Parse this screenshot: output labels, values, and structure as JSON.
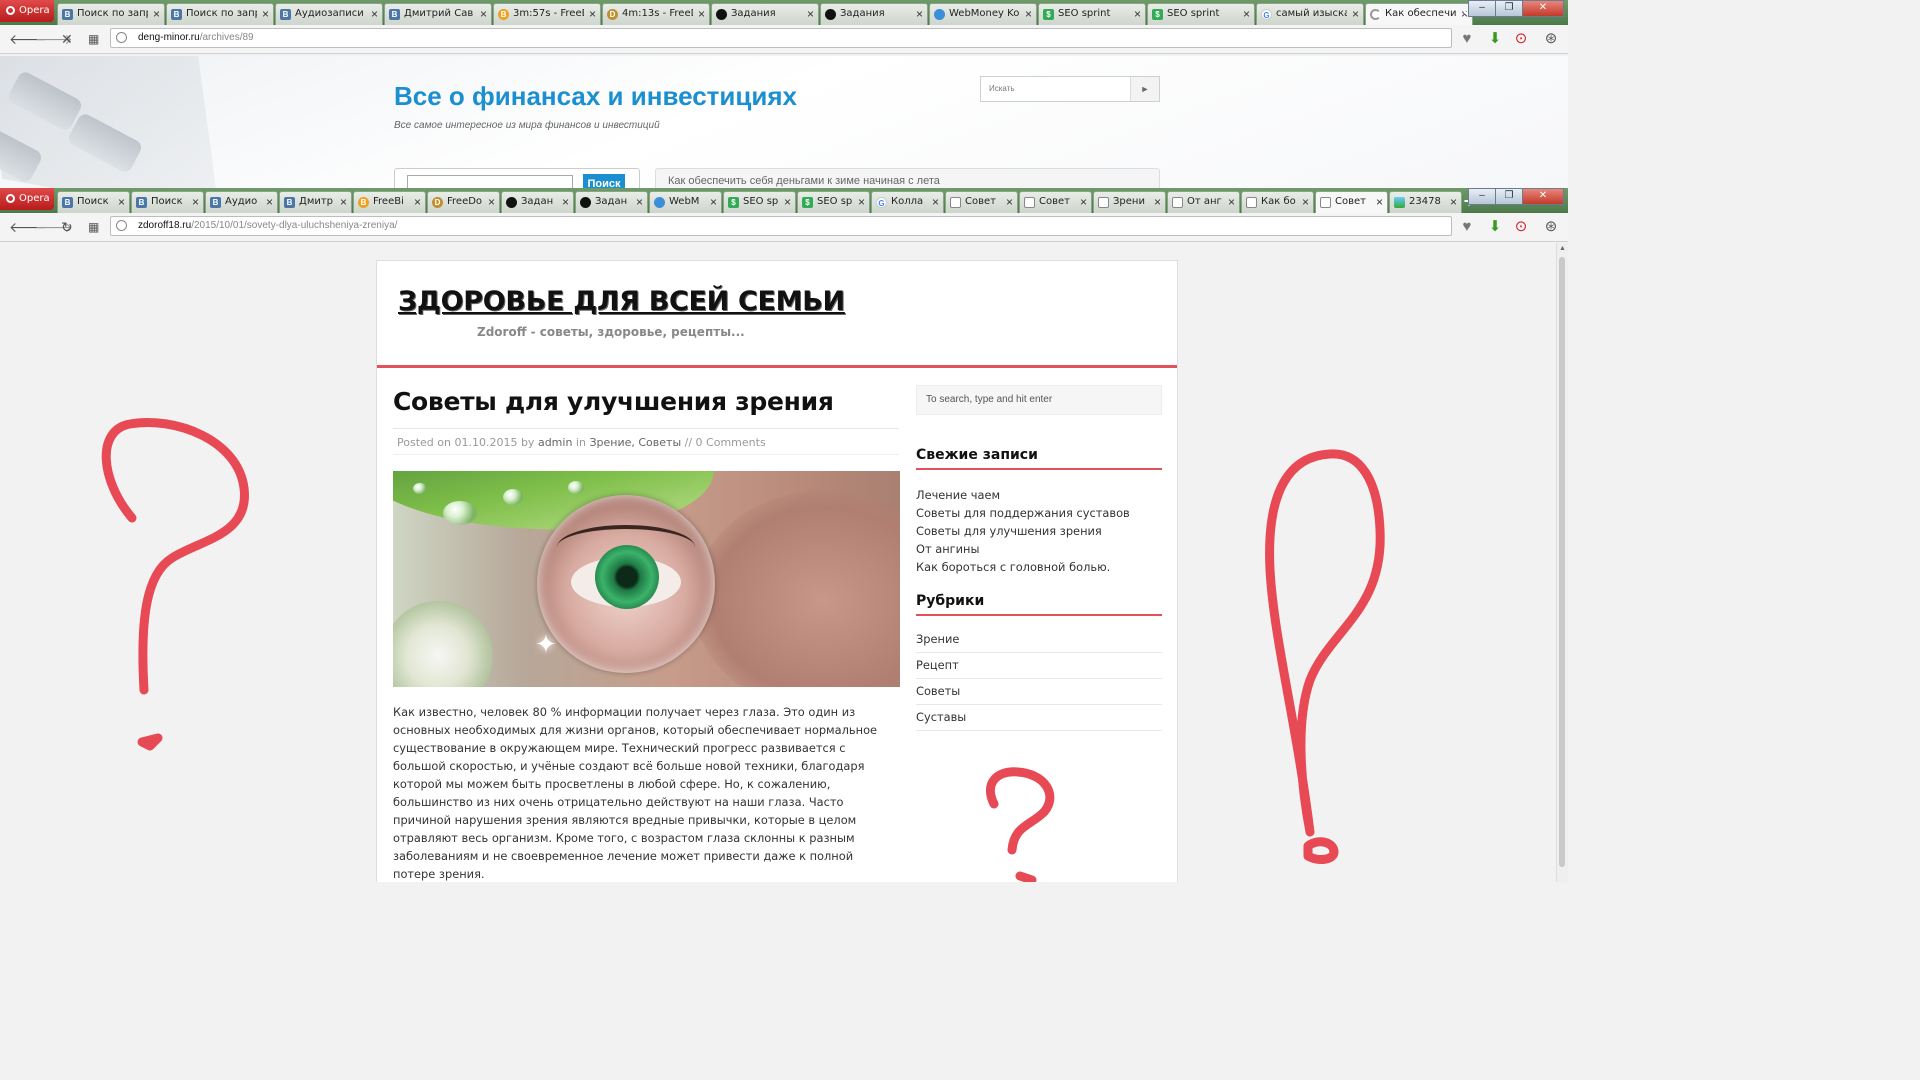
{
  "back_window": {
    "opera_label": "Opera",
    "tabs": [
      {
        "label": "Поиск по запр",
        "icon": "vk"
      },
      {
        "label": "Поиск по запр",
        "icon": "vk"
      },
      {
        "label": "Аудиозаписи Д",
        "icon": "vk"
      },
      {
        "label": "Дмитрий Сав",
        "icon": "vk"
      },
      {
        "label": "3m:57s - FreeB",
        "icon": "freebitcoin"
      },
      {
        "label": "4m:13s - FreeD",
        "icon": "freedogecoin"
      },
      {
        "label": "Задания",
        "icon": "black-circle"
      },
      {
        "label": "Задания",
        "icon": "black-circle"
      },
      {
        "label": "WebMoney Ko",
        "icon": "webmoney"
      },
      {
        "label": "SEO sprint",
        "icon": "seosprint"
      },
      {
        "label": "SEO sprint",
        "icon": "seosprint"
      },
      {
        "label": "самый изыскан",
        "icon": "google"
      },
      {
        "label": "Как обеспечи",
        "icon": "loading",
        "active": true
      }
    ],
    "url_domain": "deng-minor.ru",
    "url_path": "/archives/89",
    "site_title": "Все о финансах и инвестициях",
    "site_subtitle": "Все самое интересное из мира финансов и инвестиций",
    "search_placeholder": "Искать",
    "search_button_glyph": "►",
    "search_form_button": "Поиск",
    "ticker_text": "Как обеспечить себя деньгами к зиме начиная с лета"
  },
  "front_window": {
    "opera_label": "Opera",
    "tabs": [
      {
        "label": "Поиск",
        "icon": "vk"
      },
      {
        "label": "Поиск",
        "icon": "vk"
      },
      {
        "label": "Аудио",
        "icon": "vk"
      },
      {
        "label": "Дмитр",
        "icon": "vk"
      },
      {
        "label": "FreeBi",
        "icon": "freebitcoin"
      },
      {
        "label": "FreeDo",
        "icon": "freedogecoin"
      },
      {
        "label": "Задан",
        "icon": "black-circle"
      },
      {
        "label": "Задан",
        "icon": "black-circle"
      },
      {
        "label": "WebM",
        "icon": "webmoney"
      },
      {
        "label": "SEO sp",
        "icon": "seosprint"
      },
      {
        "label": "SEO sp",
        "icon": "seosprint"
      },
      {
        "label": "Колла",
        "icon": "google"
      },
      {
        "label": "Совет",
        "icon": "document"
      },
      {
        "label": "Совет",
        "icon": "document"
      },
      {
        "label": "Зрени",
        "icon": "document"
      },
      {
        "label": "От анг",
        "icon": "document"
      },
      {
        "label": "Как бо",
        "icon": "document"
      },
      {
        "label": "Совет",
        "icon": "document",
        "active": true
      },
      {
        "label": "23478",
        "icon": "image"
      }
    ],
    "url_domain": "zdoroff18.ru",
    "url_path": "/2015/10/01/sovety-dlya-uluchsheniya-zreniya/",
    "site_title": "ЗДОРОВЬЕ ДЛЯ ВСЕЙ СЕМЬИ",
    "site_tagline": "Zdoroff - советы, здоровье, рецепты...",
    "post": {
      "title": "Советы для улучшения зрения",
      "meta_posted_on": "Posted on",
      "meta_date": "01.10.2015",
      "meta_by": "by",
      "meta_author": "admin",
      "meta_in": "in",
      "meta_cat1": "Зрение",
      "meta_cat2": "Советы",
      "meta_comments": "// 0 Comments",
      "body": "Как известно, человек 80 % информации получает через глаза. Это один из основных необходимых для жизни органов, который обеспечивает нормальное существование в окружающем мире. Технический прогресс развивается с большой скоростью, и учёные создают всё больше новой техники, благодаря которой мы можем быть просветлены в любой сфере. Но, к сожалению, большинство из них очень отрицательно действуют на наши глаза. Часто причиной нарушения зрения являются вредные привычки, которые в целом отравляют весь организм. Кроме того, с возрастом глаза склонны к разным заболеваниям и не своевременное лечение может привести даже к полной потере зрения."
    },
    "sidebar": {
      "search_placeholder": "To search, type and hit enter",
      "recent_heading": "Свежие записи",
      "recent_posts": [
        "Лечение чаем",
        "Советы для поддержания суставов",
        "Советы для улучшения зрения",
        "От ангины",
        "Как бороться с головной болью."
      ],
      "categories_heading": "Рубрики",
      "categories": [
        "Зрение",
        "Рецепт",
        "Советы",
        "Суставы"
      ]
    }
  },
  "colors": {
    "accent_red": "#e2525a",
    "back_title_blue": "#1b8fd0",
    "doodle_red": "#e84a55",
    "opera_red": "#c8282a",
    "tabbar_green": "#5a8a56"
  }
}
